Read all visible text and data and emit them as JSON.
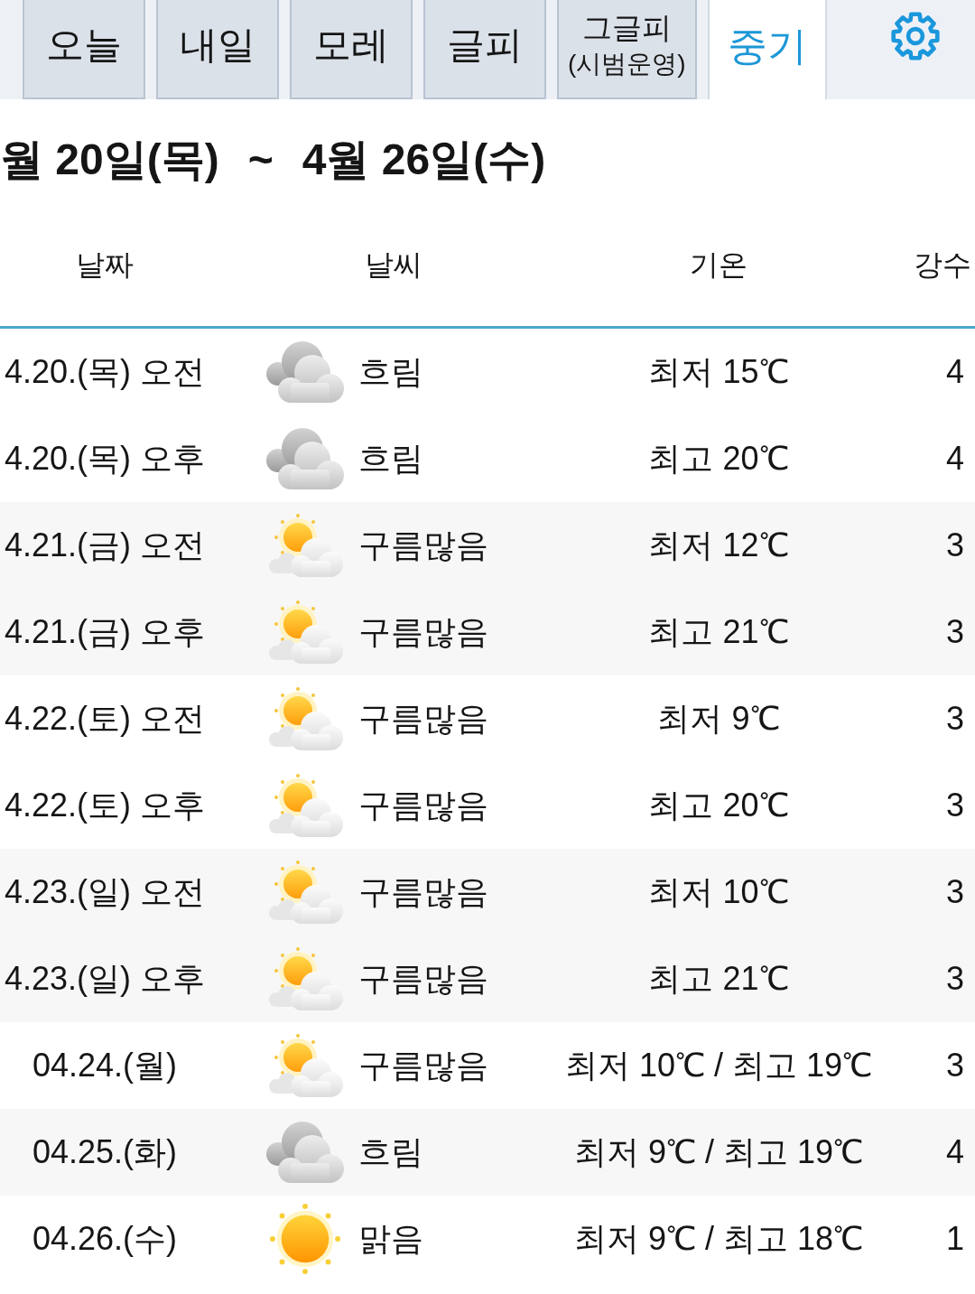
{
  "tabs": [
    {
      "label": "오늘",
      "selected": false
    },
    {
      "label": "내일",
      "selected": false
    },
    {
      "label": "모레",
      "selected": false
    },
    {
      "label": "글피",
      "selected": false
    },
    {
      "label": "그글피",
      "note": "(시범운영)",
      "selected": false
    },
    {
      "label": "중기",
      "selected": true
    }
  ],
  "range": {
    "start": "월 20일(목)",
    "separator": "~",
    "end": "4월 26일(수)"
  },
  "table": {
    "columns": [
      "날짜",
      "날씨",
      "기온",
      "강수"
    ],
    "days": [
      {
        "rows": [
          {
            "date": "4.20.(목) 오전",
            "kind": "cloudy",
            "weather": "흐림",
            "temperature": "최저 15℃",
            "precipitation": "4"
          },
          {
            "date": "4.20.(목) 오후",
            "kind": "cloudy",
            "weather": "흐림",
            "temperature": "최고 20℃",
            "precipitation": "4"
          }
        ]
      },
      {
        "rows": [
          {
            "date": "4.21.(금) 오전",
            "kind": "mostly_cloudy",
            "weather": "구름많음",
            "temperature": "최저 12℃",
            "precipitation": "3"
          },
          {
            "date": "4.21.(금) 오후",
            "kind": "mostly_cloudy",
            "weather": "구름많음",
            "temperature": "최고 21℃",
            "precipitation": "3"
          }
        ]
      },
      {
        "rows": [
          {
            "date": "4.22.(토) 오전",
            "kind": "mostly_cloudy",
            "weather": "구름많음",
            "temperature": "최저 9℃",
            "precipitation": "3"
          },
          {
            "date": "4.22.(토) 오후",
            "kind": "mostly_cloudy",
            "weather": "구름많음",
            "temperature": "최고 20℃",
            "precipitation": "3"
          }
        ]
      },
      {
        "rows": [
          {
            "date": "4.23.(일) 오전",
            "kind": "mostly_cloudy",
            "weather": "구름많음",
            "temperature": "최저 10℃",
            "precipitation": "3"
          },
          {
            "date": "4.23.(일) 오후",
            "kind": "mostly_cloudy",
            "weather": "구름많음",
            "temperature": "최고 21℃",
            "precipitation": "3"
          }
        ]
      },
      {
        "rows": [
          {
            "date": "04.24.(월)",
            "kind": "mostly_cloudy",
            "weather": "구름많음",
            "temperature": "최저 10℃ / 최고 19℃",
            "precipitation": "3"
          }
        ]
      },
      {
        "rows": [
          {
            "date": "04.25.(화)",
            "kind": "cloudy",
            "weather": "흐림",
            "temperature": "최저 9℃ / 최고 19℃",
            "precipitation": "4"
          }
        ]
      },
      {
        "rows": [
          {
            "date": "04.26.(수)",
            "kind": "sunny",
            "weather": "맑음",
            "temperature": "최저 9℃ / 최고 18℃",
            "precipitation": "1"
          }
        ]
      }
    ]
  }
}
